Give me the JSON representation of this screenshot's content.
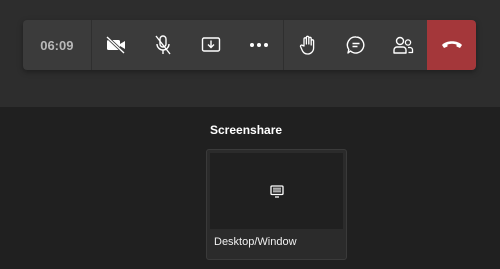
{
  "meeting_controls": {
    "timer": "06:09",
    "buttons": [
      {
        "name": "camera-off",
        "icon": "video-off-icon"
      },
      {
        "name": "mic-off",
        "icon": "mic-off-icon"
      },
      {
        "name": "share-tray",
        "icon": "share-tray-icon"
      },
      {
        "name": "more-actions",
        "icon": "more-icon"
      },
      {
        "name": "raise-hand",
        "icon": "hand-icon"
      },
      {
        "name": "chat",
        "icon": "chat-icon"
      },
      {
        "name": "participants",
        "icon": "people-icon"
      },
      {
        "name": "hang-up",
        "icon": "phone-hangup-icon"
      }
    ],
    "colors": {
      "toolbar": "#3b3b3b",
      "hangup": "#a4373a",
      "icon": "#ffffff"
    }
  },
  "share_tray": {
    "title": "Screenshare",
    "options": [
      {
        "label": "Desktop/Window",
        "icon": "monitor-icon"
      }
    ]
  }
}
